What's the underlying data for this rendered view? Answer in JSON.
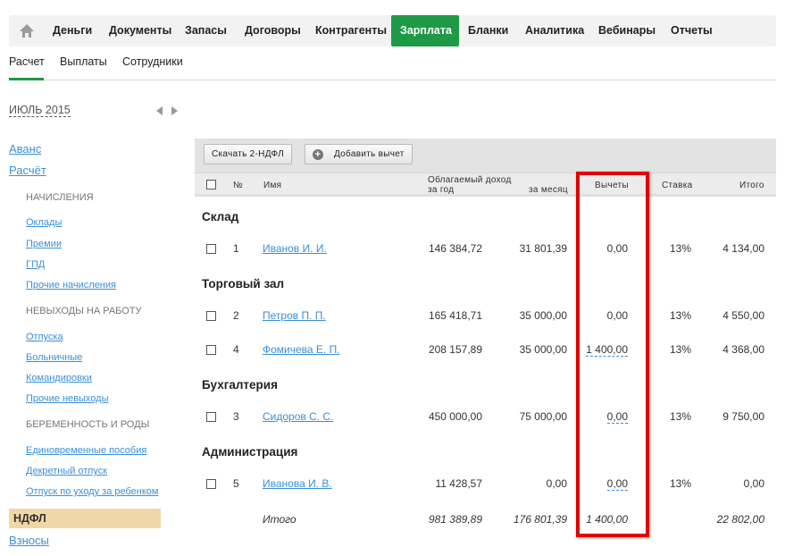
{
  "topnav": {
    "items": [
      "Деньги",
      "Документы",
      "Запасы",
      "Договоры",
      "Контрагенты",
      "Зарплата",
      "Бланки",
      "Аналитика",
      "Вебинары",
      "Отчеты"
    ],
    "active": "Зарплата"
  },
  "subnav": {
    "items": [
      "Расчет",
      "Выплаты",
      "Сотрудники"
    ],
    "active": "Расчет"
  },
  "period": "ИЮЛЬ 2015",
  "sidebar": {
    "avans": "Аванс",
    "raschet": "Расчёт",
    "sections": [
      {
        "title": "НАЧИСЛЕНИЯ",
        "links": [
          "Оклады",
          "Премии",
          "ГПД",
          "Прочие начисления"
        ]
      },
      {
        "title": "НЕВЫХОДЫ НА РАБОТУ",
        "links": [
          "Отпуска",
          "Больничные",
          "Командировки",
          "Прочие невыходы"
        ]
      },
      {
        "title": "БЕРЕМЕННОСТЬ И РОДЫ",
        "links": [
          "Единовременные пособия",
          "Декретный отпуск",
          "Отпуск по уходу за ребенком"
        ]
      }
    ],
    "active": "НДФЛ",
    "vznosy": "Взносы"
  },
  "toolbar": {
    "download": "Скачать 2-НДФЛ",
    "add_deduction": "Добавить вычет"
  },
  "table": {
    "headers": {
      "num": "№",
      "name": "Имя",
      "income": "Облагаемый доход",
      "year": "за год",
      "month": "за месяц",
      "deductions": "Вычеты",
      "rate": "Ставка",
      "total": "Итого"
    },
    "groups": [
      {
        "name": "Склад",
        "rows": [
          {
            "num": "1",
            "name": "Иванов И. И.",
            "year": "146 384,72",
            "month": "31 801,39",
            "deduction": "0,00",
            "rate": "13%",
            "total": "4 134,00"
          }
        ]
      },
      {
        "name": "Торговый зал",
        "rows": [
          {
            "num": "2",
            "name": "Петров П. П.",
            "year": "165 418,71",
            "month": "35 000,00",
            "deduction": "0,00",
            "rate": "13%",
            "total": "4 550,00"
          },
          {
            "num": "4",
            "name": "Фомичева Е. П.",
            "year": "208 157,89",
            "month": "35 000,00",
            "deduction": "1 400,00",
            "rate": "13%",
            "total": "4 368,00"
          }
        ]
      },
      {
        "name": "Бухгалтерия",
        "rows": [
          {
            "num": "3",
            "name": "Сидоров С. С.",
            "year": "450 000,00",
            "month": "75 000,00",
            "deduction": "0,00",
            "rate": "13%",
            "total": "9 750,00"
          }
        ]
      },
      {
        "name": "Администрация",
        "rows": [
          {
            "num": "5",
            "name": "Иванова И. В.",
            "year": "11 428,57",
            "month": "0,00",
            "deduction": "0,00",
            "rate": "13%",
            "total": "0,00"
          }
        ]
      }
    ],
    "totals": {
      "label": "Итого",
      "year": "981 389,89",
      "month": "176 801,39",
      "deduction": "1 400,00",
      "total": "22 802,00"
    }
  },
  "colors": {
    "accent": "#1e9a47",
    "link": "#3b8fd6",
    "highlight": "#e00000",
    "active_sidebar": "#f0d7a7"
  }
}
